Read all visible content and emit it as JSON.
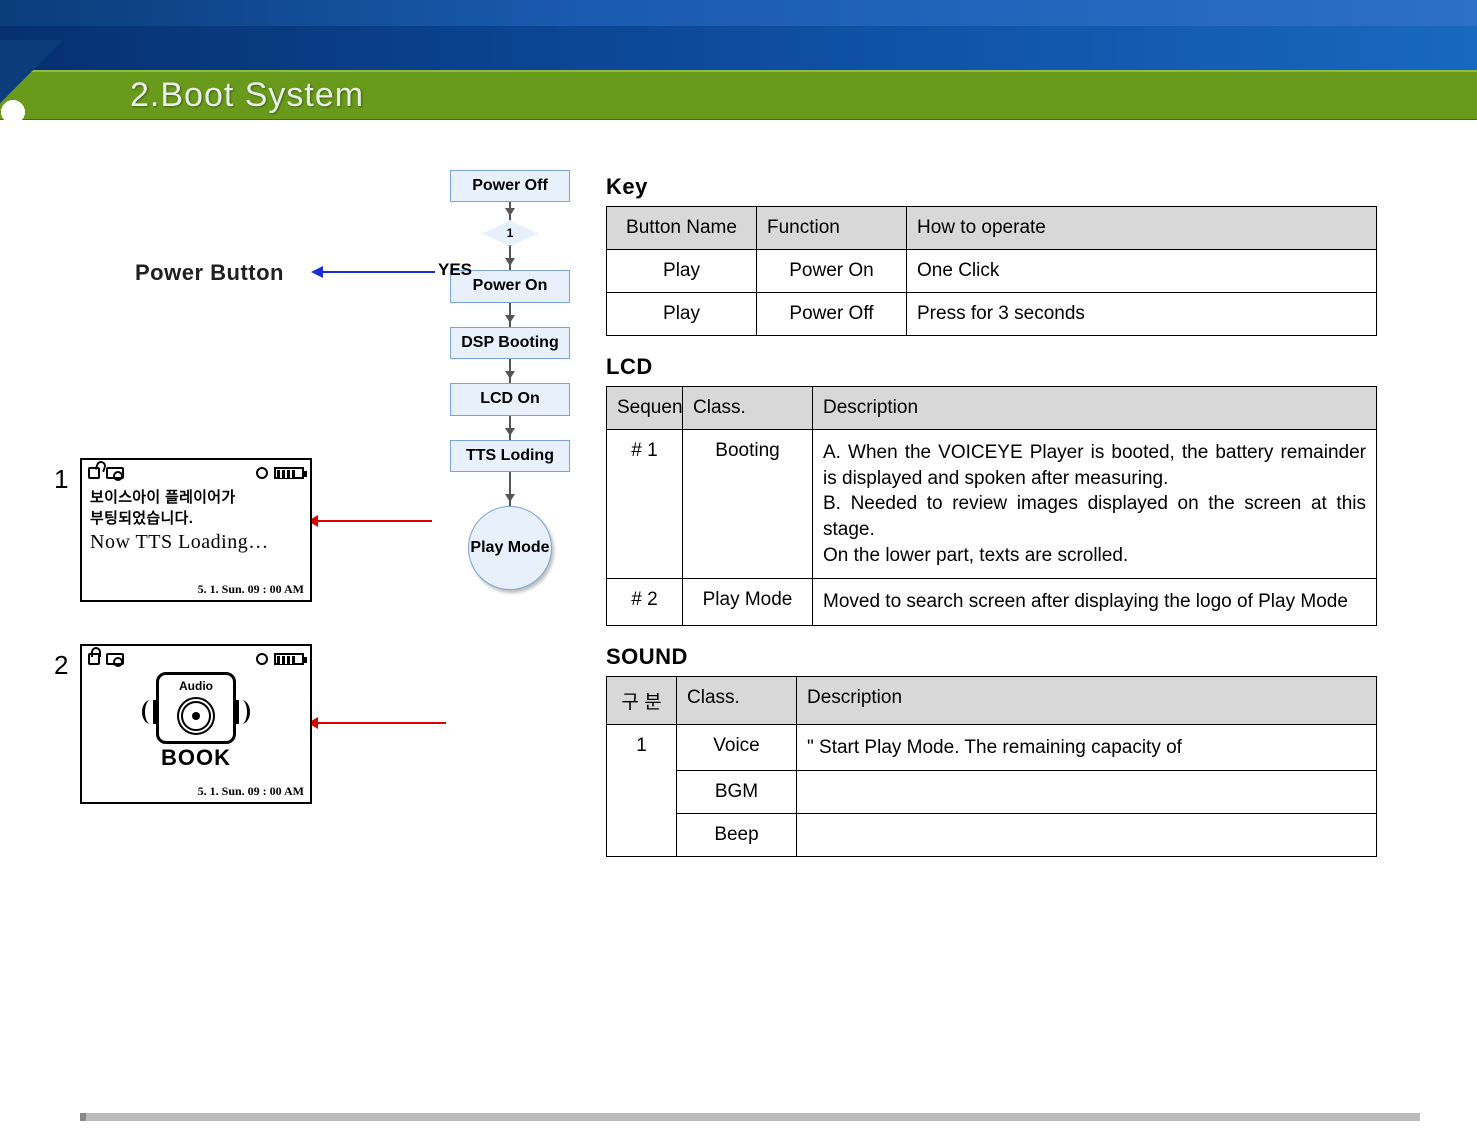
{
  "header": {
    "title": "2.Boot System"
  },
  "left": {
    "power_button_label": "Power Button",
    "yes_label": "YES",
    "flow": {
      "power_off": "Power Off",
      "diamond": "1",
      "power_on": "Power On",
      "dsp": "DSP Booting",
      "lcd_on": "LCD On",
      "tts": "TTS Loding",
      "play_mode": "Play Mode"
    },
    "mock1": {
      "num": "1",
      "k1": "보이스아이  플레이어가",
      "k2": "부팅되었습니다.",
      "sub": "Now TTS Loading…",
      "foot": "5. 1.  Sun.  09 : 00 AM"
    },
    "mock2": {
      "num": "2",
      "book": "BOOK",
      "audio": "Audio",
      "foot": "5. 1.  Sun.  09 : 00 AM"
    }
  },
  "key": {
    "title": "Key",
    "cols": {
      "c1": "Button Name",
      "c2": "Function",
      "c3": "How to operate"
    },
    "rows": [
      {
        "name": "Play",
        "func": "Power On",
        "how": "One Click"
      },
      {
        "name": "Play",
        "func": "Power Off",
        "how": "Press for 3 seconds"
      }
    ]
  },
  "lcd": {
    "title": "LCD",
    "cols": {
      "c1": "Sequen",
      "c2": "Class.",
      "c3": "Description"
    },
    "rows": [
      {
        "seq": "# 1",
        "cls": "Booting",
        "desc": "A. When the VOICEYE Player is booted, the battery remainder is displayed and spoken after measuring.\nB. Needed to review images displayed on the screen at this stage.\nOn the lower part, texts are scrolled."
      },
      {
        "seq": "# 2",
        "cls": "Play Mode",
        "desc": "Moved to search screen after displaying the logo of Play Mode"
      }
    ]
  },
  "sound": {
    "title": "SOUND",
    "cols": {
      "c1": "구 분",
      "c2": "Class.",
      "c3": "Description"
    },
    "rows": [
      {
        "seq": "1",
        "cls": "Voice",
        "desc": "\" Start Play Mode.   The remaining capacity of"
      },
      {
        "cls": "BGM",
        "desc": ""
      },
      {
        "cls": "Beep",
        "desc": ""
      }
    ]
  }
}
